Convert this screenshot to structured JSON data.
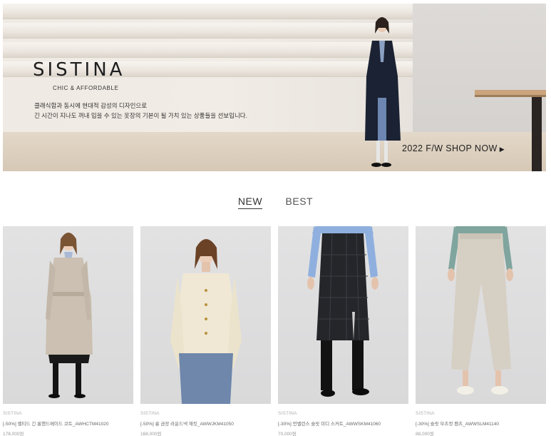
{
  "hero": {
    "brand": "SISTINA",
    "tagline": "CHIC & AFFORDABLE",
    "desc_line1": "클래식함과 동시에 현대적 감성의 디자인으로",
    "desc_line2": "긴 시간이 지나도 꺼내 입을 수 있는 옷장의 기본이 될 가치 있는 상품들을 선보입니다.",
    "cta": "2022 F/W SHOP NOW"
  },
  "tabs": [
    {
      "label": "NEW",
      "active": true
    },
    {
      "label": "BEST",
      "active": false
    }
  ],
  "products": [
    {
      "brand": "SISTINA",
      "name": "[-50%] 벨티드 긴 롱핸드메이드 코트_AWHCTM41020",
      "price": "178,000원"
    },
    {
      "brand": "SISTINA",
      "name": "[-50%] 룽 금장 라운드넥 재킷_AWWJKM41050",
      "price": "168,000원"
    },
    {
      "brand": "SISTINA",
      "name": "[-30%] 언밸런스 슬릿 미디 스커트_AWWSKM41060",
      "price": "70,000원"
    },
    {
      "brand": "SISTINA",
      "name": "[-30%] 슬릿 부츠컷 팬츠_AWWSLM41140",
      "price": "88,000원"
    }
  ]
}
